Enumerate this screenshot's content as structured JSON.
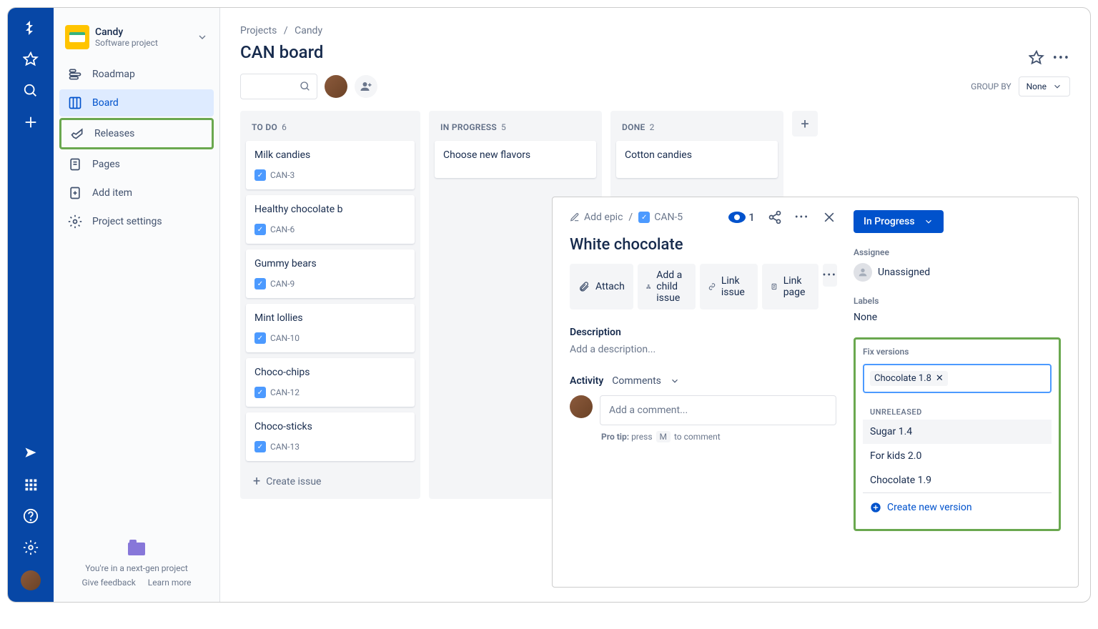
{
  "project": {
    "name": "Candy",
    "type": "Software project"
  },
  "nav": {
    "roadmap": "Roadmap",
    "board": "Board",
    "releases": "Releases",
    "pages": "Pages",
    "addItem": "Add item",
    "projectSettings": "Project settings"
  },
  "sidebarFooter": {
    "message": "You're in a next-gen project",
    "feedback": "Give feedback",
    "learn": "Learn more"
  },
  "breadcrumb": {
    "projects": "Projects",
    "sep": "/",
    "project": "Candy"
  },
  "pageTitle": "CAN board",
  "groupBy": {
    "label": "GROUP BY",
    "value": "None"
  },
  "columns": [
    {
      "name": "TO DO",
      "count": "6"
    },
    {
      "name": "IN PROGRESS",
      "count": "5"
    },
    {
      "name": "DONE",
      "count": "2"
    }
  ],
  "cardsTodo": [
    {
      "title": "Milk candies",
      "key": "CAN-3"
    },
    {
      "title": "Healthy chocolate b",
      "key": "CAN-6"
    },
    {
      "title": "Gummy bears",
      "key": "CAN-9"
    },
    {
      "title": "Mint lollies",
      "key": "CAN-10"
    },
    {
      "title": "Choco-chips",
      "key": "CAN-12"
    },
    {
      "title": "Choco-sticks",
      "key": "CAN-13"
    }
  ],
  "cardsInProgress": [
    {
      "title": "Choose new flavors"
    }
  ],
  "cardsDone": [
    {
      "title": "Cotton candies"
    }
  ],
  "createIssue": "Create issue",
  "modal": {
    "addEpic": "Add epic",
    "issueKey": "CAN-5",
    "watchCount": "1",
    "title": "White chocolate",
    "attach": "Attach",
    "addChild": "Add a child issue",
    "linkIssue": "Link issue",
    "linkPage": "Link page",
    "descLabel": "Description",
    "descPlaceholder": "Add a description...",
    "activityLabel": "Activity",
    "commentsLabel": "Comments",
    "commentPlaceholder": "Add a comment...",
    "proTipLabel": "Pro tip:",
    "proTipPress": "press",
    "proTipKey": "M",
    "proTipRest": "to comment",
    "status": "In Progress",
    "assigneeLabel": "Assignee",
    "assigneeValue": "Unassigned",
    "labelsLabel": "Labels",
    "labelsValue": "None",
    "fixVersionsLabel": "Fix versions",
    "selectedVersion": "Chocolate 1.8",
    "groupLabel": "UNRELEASED",
    "versionOptions": [
      "Sugar 1.4",
      "For kids 2.0",
      "Chocolate 1.9"
    ],
    "createVersion": "Create new version"
  }
}
